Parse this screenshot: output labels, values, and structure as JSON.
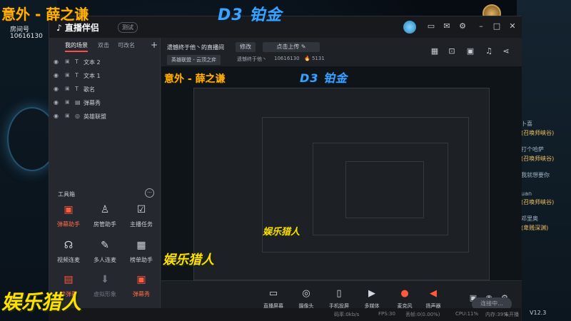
{
  "overlay": {
    "streamer_name": "意外 - 薛之谦",
    "room_label": "房间号",
    "room_id": "10616130",
    "rank_title": "D3 铂金",
    "entertainment_title": "娱乐猎人"
  },
  "app": {
    "name": "直播伴侣",
    "badge": "测试"
  },
  "scene_tabs": [
    "我的场景",
    "双击",
    "可改名"
  ],
  "sources": [
    {
      "label": "文本 2",
      "icon": "text-icon"
    },
    {
      "label": "文本 1",
      "icon": "text-icon"
    },
    {
      "label": "歌名",
      "icon": "text-icon"
    },
    {
      "label": "弹幕秀",
      "icon": "comment-icon"
    },
    {
      "label": "英雄联盟",
      "icon": "game-icon"
    }
  ],
  "tools": {
    "title": "工具箱",
    "items": [
      {
        "label": "弹幕助手",
        "style": "red",
        "icon": "chat-icon"
      },
      {
        "label": "房管助手",
        "style": "normal",
        "icon": "admin-icon"
      },
      {
        "label": "主播任务",
        "style": "normal",
        "icon": "task-icon"
      },
      {
        "label": "视频连麦",
        "style": "normal",
        "icon": "video-call-icon"
      },
      {
        "label": "多人连麦",
        "style": "normal",
        "icon": "multi-call-icon"
      },
      {
        "label": "榜单助手",
        "style": "normal",
        "icon": "ranking-icon"
      },
      {
        "label": "读弹幕",
        "style": "red",
        "icon": "read-comment-icon"
      },
      {
        "label": "虚拟形象",
        "style": "dim",
        "icon": "avatar-icon"
      },
      {
        "label": "弹幕秀",
        "style": "red",
        "icon": "comment-show-icon"
      }
    ]
  },
  "header": {
    "title": "遗憾终于他丶的直播间",
    "edit_label": "修改",
    "cover_label": "点击上传",
    "category": "英雄联盟 - 云顶之弈",
    "owner": "遗憾终于他丶",
    "room_id": "10616130",
    "heat": "5131"
  },
  "bottom_tools": [
    {
      "label": "直播屏幕",
      "icon": "screen-icon"
    },
    {
      "label": "摄像头",
      "icon": "camera-icon"
    },
    {
      "label": "手机投屏",
      "icon": "phone-cast-icon"
    },
    {
      "label": "多媒体",
      "icon": "media-icon"
    },
    {
      "label": "麦克风",
      "icon": "mic-icon"
    },
    {
      "label": "扬声器",
      "icon": "speaker-icon"
    }
  ],
  "live_button": "连接中...",
  "status": {
    "bitrate": "码率:0kb/s",
    "fps": "FPS:30",
    "drop": "丢帧:0(0.00%)",
    "cpu": "CPU:11%",
    "mem": "内存:39%",
    "net": "未开播",
    "version": "V12.3"
  },
  "chat_side": [
    {
      "name": "卜喜"
    },
    {
      "name": "(召唤师峡谷)"
    },
    {
      "name": "打个哈萨"
    },
    {
      "name": "(召唤师峡谷)"
    },
    {
      "name": "我就想要你"
    },
    {
      "name": "uan"
    },
    {
      "name": "(召唤师峡谷)"
    },
    {
      "name": "邓里奥"
    },
    {
      "name": "(卑贱深渊)"
    }
  ],
  "colors": {
    "accent_red": "#ff4b4b",
    "overlay_orange": "#ffb300",
    "overlay_blue": "#3aa2ff",
    "overlay_yellow": "#ffe000",
    "window_bg": "#1e2126"
  }
}
